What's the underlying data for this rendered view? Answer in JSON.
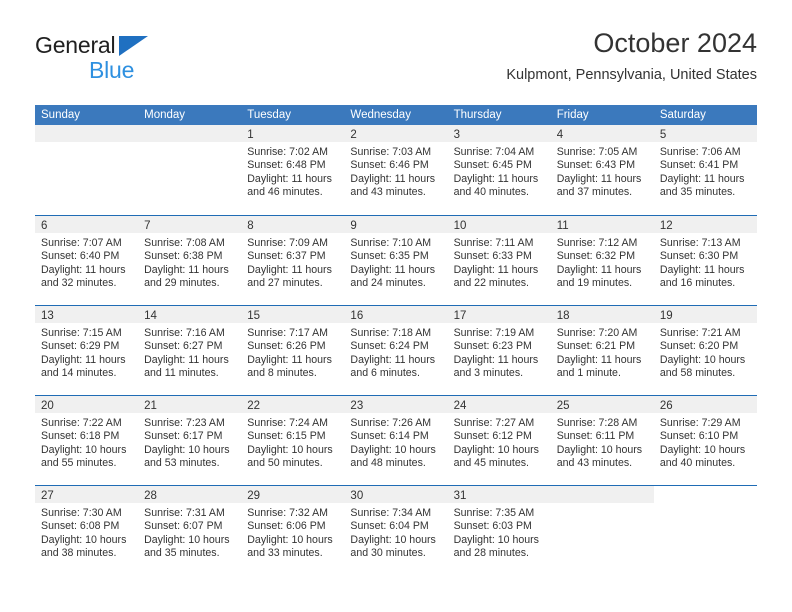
{
  "brand": {
    "name_top": "General",
    "name_bottom": "Blue",
    "triangle_color": "#1f70c1",
    "bottom_text_color": "#2e90e0"
  },
  "header": {
    "title": "October 2024",
    "location": "Kulpmont, Pennsylvania, United States"
  },
  "colors": {
    "header_row_bg": "#3b79bd",
    "header_row_text": "#ffffff",
    "week_divider": "#1f6cb5",
    "daynum_bar_bg": "#f0f0f0",
    "text": "#333333",
    "page_bg": "#ffffff"
  },
  "weekdays": [
    "Sunday",
    "Monday",
    "Tuesday",
    "Wednesday",
    "Thursday",
    "Friday",
    "Saturday"
  ],
  "weeks": [
    [
      {
        "day": "",
        "lines": [],
        "shaded": true
      },
      {
        "day": "",
        "lines": [],
        "shaded": true
      },
      {
        "day": "1",
        "lines": [
          "Sunrise: 7:02 AM",
          "Sunset: 6:48 PM",
          "Daylight: 11 hours",
          "and 46 minutes."
        ],
        "shaded": true
      },
      {
        "day": "2",
        "lines": [
          "Sunrise: 7:03 AM",
          "Sunset: 6:46 PM",
          "Daylight: 11 hours",
          "and 43 minutes."
        ],
        "shaded": true
      },
      {
        "day": "3",
        "lines": [
          "Sunrise: 7:04 AM",
          "Sunset: 6:45 PM",
          "Daylight: 11 hours",
          "and 40 minutes."
        ],
        "shaded": true
      },
      {
        "day": "4",
        "lines": [
          "Sunrise: 7:05 AM",
          "Sunset: 6:43 PM",
          "Daylight: 11 hours",
          "and 37 minutes."
        ],
        "shaded": true
      },
      {
        "day": "5",
        "lines": [
          "Sunrise: 7:06 AM",
          "Sunset: 6:41 PM",
          "Daylight: 11 hours",
          "and 35 minutes."
        ],
        "shaded": true
      }
    ],
    [
      {
        "day": "6",
        "lines": [
          "Sunrise: 7:07 AM",
          "Sunset: 6:40 PM",
          "Daylight: 11 hours",
          "and 32 minutes."
        ],
        "shaded": true
      },
      {
        "day": "7",
        "lines": [
          "Sunrise: 7:08 AM",
          "Sunset: 6:38 PM",
          "Daylight: 11 hours",
          "and 29 minutes."
        ],
        "shaded": true
      },
      {
        "day": "8",
        "lines": [
          "Sunrise: 7:09 AM",
          "Sunset: 6:37 PM",
          "Daylight: 11 hours",
          "and 27 minutes."
        ],
        "shaded": true
      },
      {
        "day": "9",
        "lines": [
          "Sunrise: 7:10 AM",
          "Sunset: 6:35 PM",
          "Daylight: 11 hours",
          "and 24 minutes."
        ],
        "shaded": true
      },
      {
        "day": "10",
        "lines": [
          "Sunrise: 7:11 AM",
          "Sunset: 6:33 PM",
          "Daylight: 11 hours",
          "and 22 minutes."
        ],
        "shaded": true
      },
      {
        "day": "11",
        "lines": [
          "Sunrise: 7:12 AM",
          "Sunset: 6:32 PM",
          "Daylight: 11 hours",
          "and 19 minutes."
        ],
        "shaded": true
      },
      {
        "day": "12",
        "lines": [
          "Sunrise: 7:13 AM",
          "Sunset: 6:30 PM",
          "Daylight: 11 hours",
          "and 16 minutes."
        ],
        "shaded": true
      }
    ],
    [
      {
        "day": "13",
        "lines": [
          "Sunrise: 7:15 AM",
          "Sunset: 6:29 PM",
          "Daylight: 11 hours",
          "and 14 minutes."
        ],
        "shaded": true
      },
      {
        "day": "14",
        "lines": [
          "Sunrise: 7:16 AM",
          "Sunset: 6:27 PM",
          "Daylight: 11 hours",
          "and 11 minutes."
        ],
        "shaded": true
      },
      {
        "day": "15",
        "lines": [
          "Sunrise: 7:17 AM",
          "Sunset: 6:26 PM",
          "Daylight: 11 hours",
          "and 8 minutes."
        ],
        "shaded": true
      },
      {
        "day": "16",
        "lines": [
          "Sunrise: 7:18 AM",
          "Sunset: 6:24 PM",
          "Daylight: 11 hours",
          "and 6 minutes."
        ],
        "shaded": true
      },
      {
        "day": "17",
        "lines": [
          "Sunrise: 7:19 AM",
          "Sunset: 6:23 PM",
          "Daylight: 11 hours",
          "and 3 minutes."
        ],
        "shaded": true
      },
      {
        "day": "18",
        "lines": [
          "Sunrise: 7:20 AM",
          "Sunset: 6:21 PM",
          "Daylight: 11 hours",
          "and 1 minute."
        ],
        "shaded": true
      },
      {
        "day": "19",
        "lines": [
          "Sunrise: 7:21 AM",
          "Sunset: 6:20 PM",
          "Daylight: 10 hours",
          "and 58 minutes."
        ],
        "shaded": true
      }
    ],
    [
      {
        "day": "20",
        "lines": [
          "Sunrise: 7:22 AM",
          "Sunset: 6:18 PM",
          "Daylight: 10 hours",
          "and 55 minutes."
        ],
        "shaded": true
      },
      {
        "day": "21",
        "lines": [
          "Sunrise: 7:23 AM",
          "Sunset: 6:17 PM",
          "Daylight: 10 hours",
          "and 53 minutes."
        ],
        "shaded": true
      },
      {
        "day": "22",
        "lines": [
          "Sunrise: 7:24 AM",
          "Sunset: 6:15 PM",
          "Daylight: 10 hours",
          "and 50 minutes."
        ],
        "shaded": true
      },
      {
        "day": "23",
        "lines": [
          "Sunrise: 7:26 AM",
          "Sunset: 6:14 PM",
          "Daylight: 10 hours",
          "and 48 minutes."
        ],
        "shaded": true
      },
      {
        "day": "24",
        "lines": [
          "Sunrise: 7:27 AM",
          "Sunset: 6:12 PM",
          "Daylight: 10 hours",
          "and 45 minutes."
        ],
        "shaded": true
      },
      {
        "day": "25",
        "lines": [
          "Sunrise: 7:28 AM",
          "Sunset: 6:11 PM",
          "Daylight: 10 hours",
          "and 43 minutes."
        ],
        "shaded": true
      },
      {
        "day": "26",
        "lines": [
          "Sunrise: 7:29 AM",
          "Sunset: 6:10 PM",
          "Daylight: 10 hours",
          "and 40 minutes."
        ],
        "shaded": true
      }
    ],
    [
      {
        "day": "27",
        "lines": [
          "Sunrise: 7:30 AM",
          "Sunset: 6:08 PM",
          "Daylight: 10 hours",
          "and 38 minutes."
        ],
        "shaded": true
      },
      {
        "day": "28",
        "lines": [
          "Sunrise: 7:31 AM",
          "Sunset: 6:07 PM",
          "Daylight: 10 hours",
          "and 35 minutes."
        ],
        "shaded": true
      },
      {
        "day": "29",
        "lines": [
          "Sunrise: 7:32 AM",
          "Sunset: 6:06 PM",
          "Daylight: 10 hours",
          "and 33 minutes."
        ],
        "shaded": true
      },
      {
        "day": "30",
        "lines": [
          "Sunrise: 7:34 AM",
          "Sunset: 6:04 PM",
          "Daylight: 10 hours",
          "and 30 minutes."
        ],
        "shaded": true
      },
      {
        "day": "31",
        "lines": [
          "Sunrise: 7:35 AM",
          "Sunset: 6:03 PM",
          "Daylight: 10 hours",
          "and 28 minutes."
        ],
        "shaded": true
      },
      {
        "day": "",
        "lines": [],
        "shaded": true
      },
      {
        "day": "",
        "lines": [],
        "shaded": false
      }
    ]
  ]
}
